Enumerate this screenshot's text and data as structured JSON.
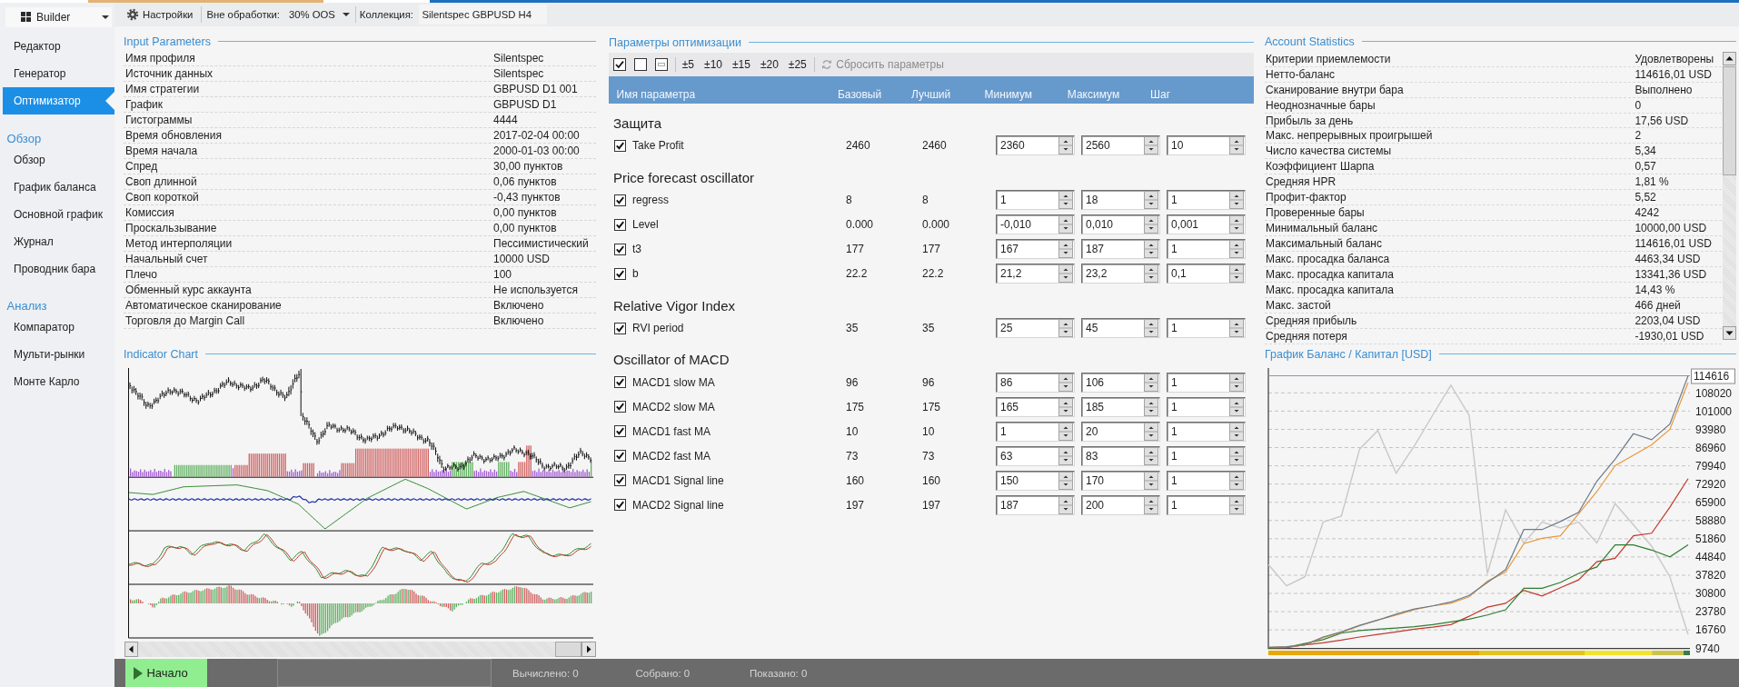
{
  "sidebar": {
    "dropdown": {
      "label": "Builder"
    },
    "groups": [
      {
        "items": [
          {
            "label": "Редактор",
            "selected": false
          },
          {
            "label": "Генератор",
            "selected": false
          },
          {
            "label": "Оптимизатор",
            "selected": true
          }
        ]
      },
      {
        "title": "Обзор",
        "items": [
          {
            "label": "Обзор",
            "selected": false
          },
          {
            "label": "График баланса",
            "selected": false
          },
          {
            "label": "Основной график",
            "selected": false
          },
          {
            "label": "Журнал",
            "selected": false
          },
          {
            "label": "Проводник бара",
            "selected": false
          }
        ]
      },
      {
        "title": "Анализ",
        "items": [
          {
            "label": "Компаратор",
            "selected": false
          },
          {
            "label": "Мульти-рынки",
            "selected": false
          },
          {
            "label": "Монте Карло",
            "selected": false
          }
        ]
      }
    ]
  },
  "toolbar": {
    "settings": "Настройки",
    "out_of_sample": {
      "label": "Вне обработки:",
      "value": "30% OOS"
    },
    "collection": {
      "label": "Коллекция:",
      "value": "Silentspec GBPUSD H4"
    }
  },
  "input_parameters": {
    "title": "Input Parameters",
    "rows": [
      {
        "label": "Имя профиля",
        "value": "Silentspec"
      },
      {
        "label": "Источник данных",
        "value": "Silentspec"
      },
      {
        "label": "Имя стратегии",
        "value": "GBPUSD D1 001"
      },
      {
        "label": "График",
        "value": "GBPUSD D1"
      },
      {
        "label": "Гистограммы",
        "value": "4444"
      },
      {
        "label": "Время обновления",
        "value": "2017-02-04 00:00"
      },
      {
        "label": "Время начала",
        "value": "2000-01-03 00:00"
      },
      {
        "label": "Спред",
        "value": "30,00 пунктов"
      },
      {
        "label": "Своп длинной",
        "value": "0,06 пунктов"
      },
      {
        "label": "Своп короткой",
        "value": "-0,43 пунктов"
      },
      {
        "label": "Комиссия",
        "value": "0,00 пунктов"
      },
      {
        "label": "Проскальзывание",
        "value": "0,00 пунктов"
      },
      {
        "label": "Метод интерполяции",
        "value": "Пессимистический"
      },
      {
        "label": "Начальный счет",
        "value": "10000 USD"
      },
      {
        "label": "Плечо",
        "value": "100"
      },
      {
        "label": "Обменный курс аккаунта",
        "value": "Не используется"
      },
      {
        "label": "Автоматическое сканирование",
        "value": "Включено"
      },
      {
        "label": "Торговля до Margin Call",
        "value": "Включено"
      }
    ]
  },
  "indicator_chart": {
    "title": "Indicator Chart"
  },
  "optimization": {
    "title": "Параметры оптимизации",
    "toolbar": {
      "steps": [
        "±5",
        "±10",
        "±15",
        "±20",
        "±25"
      ],
      "reset": {
        "label": "Сбросить параметры",
        "disabled": true
      }
    },
    "columns": [
      "Имя параметра",
      "Базовый",
      "Лучший",
      "Минимум",
      "Максимум",
      "Шаг"
    ],
    "groups": [
      {
        "title": "Защита",
        "rows": [
          {
            "checked": true,
            "name": "Take Profit",
            "base": "2460",
            "best": "2460",
            "min": "2360",
            "max": "2560",
            "step": "10"
          }
        ]
      },
      {
        "title": "Price forecast oscillator",
        "rows": [
          {
            "checked": true,
            "name": "regress",
            "base": "8",
            "best": "8",
            "min": "1",
            "max": "18",
            "step": "1"
          },
          {
            "checked": true,
            "name": "Level",
            "base": "0.000",
            "best": "0.000",
            "min": "-0,010",
            "max": "0,010",
            "step": "0,001"
          },
          {
            "checked": true,
            "name": "t3",
            "base": "177",
            "best": "177",
            "min": "167",
            "max": "187",
            "step": "1"
          },
          {
            "checked": true,
            "name": "b",
            "base": "22.2",
            "best": "22.2",
            "min": "21,2",
            "max": "23,2",
            "step": "0,1"
          }
        ]
      },
      {
        "title": "Relative Vigor Index",
        "rows": [
          {
            "checked": true,
            "name": "RVI period",
            "base": "35",
            "best": "35",
            "min": "25",
            "max": "45",
            "step": "1"
          }
        ]
      },
      {
        "title": "Oscillator of MACD",
        "rows": [
          {
            "checked": true,
            "name": "MACD1 slow MA",
            "base": "96",
            "best": "96",
            "min": "86",
            "max": "106",
            "step": "1"
          },
          {
            "checked": true,
            "name": "MACD2 slow MA",
            "base": "175",
            "best": "175",
            "min": "165",
            "max": "185",
            "step": "1"
          },
          {
            "checked": true,
            "name": "MACD1 fast MA",
            "base": "10",
            "best": "10",
            "min": "1",
            "max": "20",
            "step": "1"
          },
          {
            "checked": true,
            "name": "MACD2 fast MA",
            "base": "73",
            "best": "73",
            "min": "63",
            "max": "83",
            "step": "1"
          },
          {
            "checked": true,
            "name": "MACD1 Signal line",
            "base": "160",
            "best": "160",
            "min": "150",
            "max": "170",
            "step": "1"
          },
          {
            "checked": true,
            "name": "MACD2 Signal line",
            "base": "197",
            "best": "197",
            "min": "187",
            "max": "200",
            "step": "1"
          }
        ]
      }
    ]
  },
  "account_statistics": {
    "title": "Account Statistics",
    "rows": [
      {
        "label": "Критерии приемлемости",
        "value": "Удовлетворены"
      },
      {
        "label": "Нетто-баланс",
        "value": "114616,01 USD"
      },
      {
        "label": "Сканирование внутри бара",
        "value": "Выполнено"
      },
      {
        "label": "Неоднозначные бары",
        "value": "0"
      },
      {
        "label": "Прибыль за день",
        "value": "17,56 USD"
      },
      {
        "label": "Макс. непрерывных проигрышей",
        "value": "2"
      },
      {
        "label": "Число качества системы",
        "value": "5,34"
      },
      {
        "label": "Коэффициент Шарпа",
        "value": "0,57"
      },
      {
        "label": "Средняя HPR",
        "value": "1,81 %"
      },
      {
        "label": "Профит-фактор",
        "value": "5,52"
      },
      {
        "label": "Проверенные бары",
        "value": "4242"
      },
      {
        "label": "Минимальный баланс",
        "value": "10000,00 USD"
      },
      {
        "label": "Максимальный баланс",
        "value": "114616,01 USD"
      },
      {
        "label": "Макс. просадка баланса",
        "value": "4463,34 USD"
      },
      {
        "label": "Макс. просадка капитала",
        "value": "13341,36 USD"
      },
      {
        "label": "Макс. просадка капитала",
        "value": "14,43 %"
      },
      {
        "label": "Макс. застой",
        "value": "466 дней"
      },
      {
        "label": "Средняя прибыль",
        "value": "2203,04 USD"
      },
      {
        "label": "Средняя потеря",
        "value": "-1930,01 USD"
      }
    ]
  },
  "balance_chart": {
    "title": "График Баланс / Капитал [USD]",
    "chart_data": {
      "type": "line",
      "grid": true,
      "ylim": [
        9740,
        117000
      ],
      "yticks": [
        9740,
        16760,
        23780,
        30800,
        37820,
        44840,
        51860,
        58880,
        65900,
        72920,
        79940,
        86960,
        93980,
        101000,
        108020,
        114616
      ],
      "series": [
        {
          "color": "#c8c8c8",
          "values": [
            41900,
            33700,
            37200,
            58300,
            60600,
            86400,
            93500,
            77100,
            87600,
            99400,
            111000,
            99400,
            38400,
            63000,
            50200,
            58300,
            56000,
            58300,
            50200,
            65400,
            57200,
            49000,
            37200,
            15000
          ]
        },
        {
          "color": "#c0392b",
          "values": [
            9800,
            9900,
            11000,
            11800,
            12800,
            14000,
            15000,
            16000,
            17000,
            17800,
            18800,
            22000,
            25500,
            27000,
            32000,
            29800,
            33000,
            36000,
            43000,
            44300,
            53000,
            54000,
            64000,
            75000
          ]
        },
        {
          "color": "#2e7d32",
          "values": [
            9800,
            10000,
            11500,
            13000,
            15500,
            16500,
            17000,
            17500,
            18000,
            18800,
            19800,
            20900,
            22500,
            24500,
            32800,
            32800,
            35000,
            38500,
            41000,
            49500,
            49500,
            47500,
            44900,
            49500
          ]
        },
        {
          "color": "#e8993a",
          "values": [
            10000,
            10200,
            11000,
            13800,
            15800,
            18300,
            20600,
            22400,
            24500,
            26000,
            27000,
            29500,
            35500,
            39000,
            50000,
            52000,
            53000,
            61500,
            70000,
            80000,
            84000,
            88000,
            94000,
            112000
          ]
        },
        {
          "color": "#6b7b8c",
          "values": [
            10000,
            10300,
            11000,
            14000,
            16000,
            18500,
            20500,
            22800,
            24800,
            26000,
            27500,
            30000,
            35000,
            40000,
            55400,
            55400,
            58500,
            62000,
            74000,
            82500,
            92300,
            90000,
            96000,
            114600
          ]
        }
      ],
      "ref_lines": [
        {
          "axis": "y",
          "value": 114616,
          "color": "#8a93b3"
        }
      ]
    }
  },
  "status_bar": {
    "start": "Начало",
    "counters": [
      "Вычислено: 0",
      "Собрано: 0",
      "Показано: 0"
    ]
  }
}
